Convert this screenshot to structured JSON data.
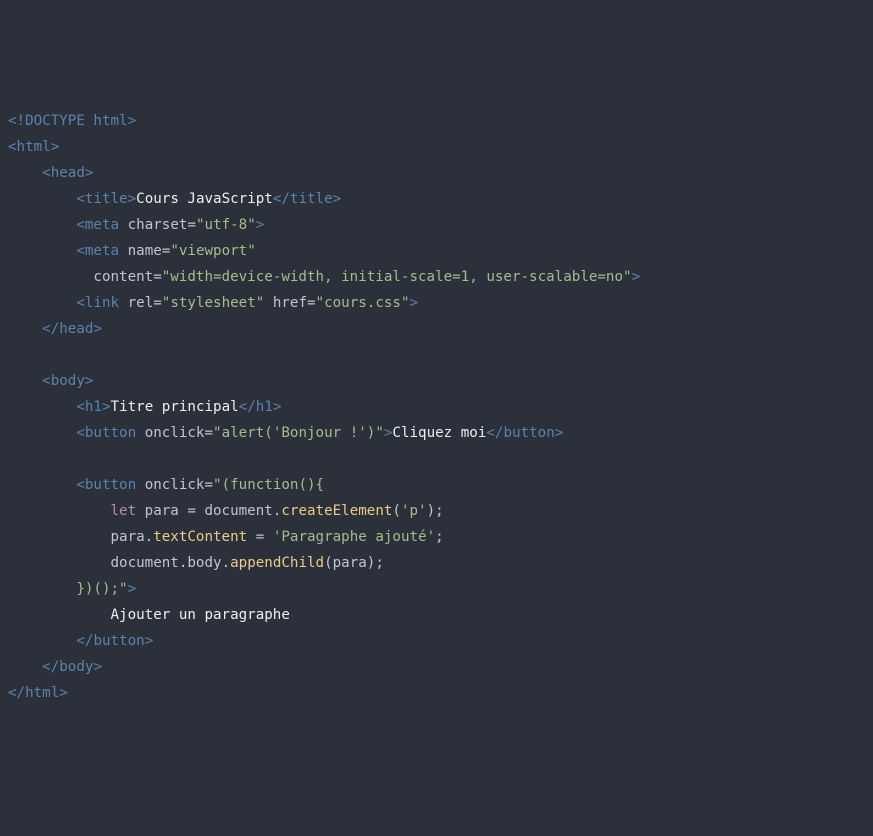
{
  "lines": {
    "doctype": "DOCTYPE html",
    "html_open": "html",
    "head_open": "head",
    "title_open": "title",
    "title_text": "Cours JavaScript",
    "title_close": "title",
    "meta1_tag": "meta",
    "meta1_attr": "charset",
    "meta1_val": "\"utf-8\"",
    "meta2_tag": "meta",
    "meta2_attr": "name",
    "meta2_val": "\"viewport\"",
    "meta2_attr2": "content",
    "meta2_val2": "\"width=device-width, initial-scale=1, user-scalable=no\"",
    "link_tag": "link",
    "link_attr1": "rel",
    "link_val1": "\"stylesheet\"",
    "link_attr2": "href",
    "link_val2": "\"cours.css\"",
    "head_close": "head",
    "body_open": "body",
    "h1_open": "h1",
    "h1_text": "Titre principal",
    "h1_close": "h1",
    "btn1_open": "button",
    "btn1_attr": "onclick",
    "btn1_val": "\"alert('Bonjour !')\"",
    "btn1_text": "Cliquez moi",
    "btn1_close": "button",
    "btn2_open": "button",
    "btn2_attr": "onclick",
    "btn2_val_line1": "\"(function(){",
    "js_let": "let",
    "js_var": "para",
    "js_eq": " = ",
    "js_doc": "document",
    "js_ce": "createElement",
    "js_arg_p": "'p'",
    "js_tc": "textContent",
    "js_text_val": "'Paragraphe ajouté'",
    "js_body": "body",
    "js_ac": "appendChild",
    "js_arg_para": "para",
    "btn2_val_line_end": "})();\"",
    "btn2_text": "Ajouter un paragraphe",
    "btn2_close": "button",
    "body_close": "body",
    "html_close": "html"
  }
}
